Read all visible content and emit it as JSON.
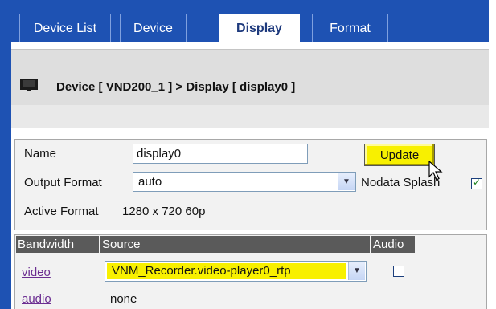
{
  "tabs": [
    {
      "label": "Device List",
      "active": false
    },
    {
      "label": "Device",
      "active": false
    },
    {
      "label": "Display",
      "active": true
    },
    {
      "label": "Format",
      "active": false
    }
  ],
  "header": {
    "breadcrumb": "Device [ VND200_1 ] > Display [ display0 ]",
    "icon": "monitor-icon"
  },
  "form": {
    "name_label": "Name",
    "name_value": "display0",
    "update_label": "Update",
    "output_format_label": "Output Format",
    "output_format_value": "auto",
    "nodata_splash_label": "Nodata Splash",
    "nodata_splash_checked": true,
    "active_format_label": "Active Format",
    "active_format_value": "1280 x 720 60p"
  },
  "table": {
    "headers": [
      "Bandwidth",
      "Source",
      "Audio"
    ],
    "rows": [
      {
        "bandwidth": "video",
        "source": "VNM_Recorder.video-player0_rtp",
        "audio_checked": false
      },
      {
        "bandwidth": "audio",
        "source": "none"
      }
    ]
  },
  "colors": {
    "frame_blue": "#1e52b3",
    "highlight_yellow": "#f8f000",
    "header_gray": "#5a5a5a",
    "link_purple": "#6b2d91"
  }
}
